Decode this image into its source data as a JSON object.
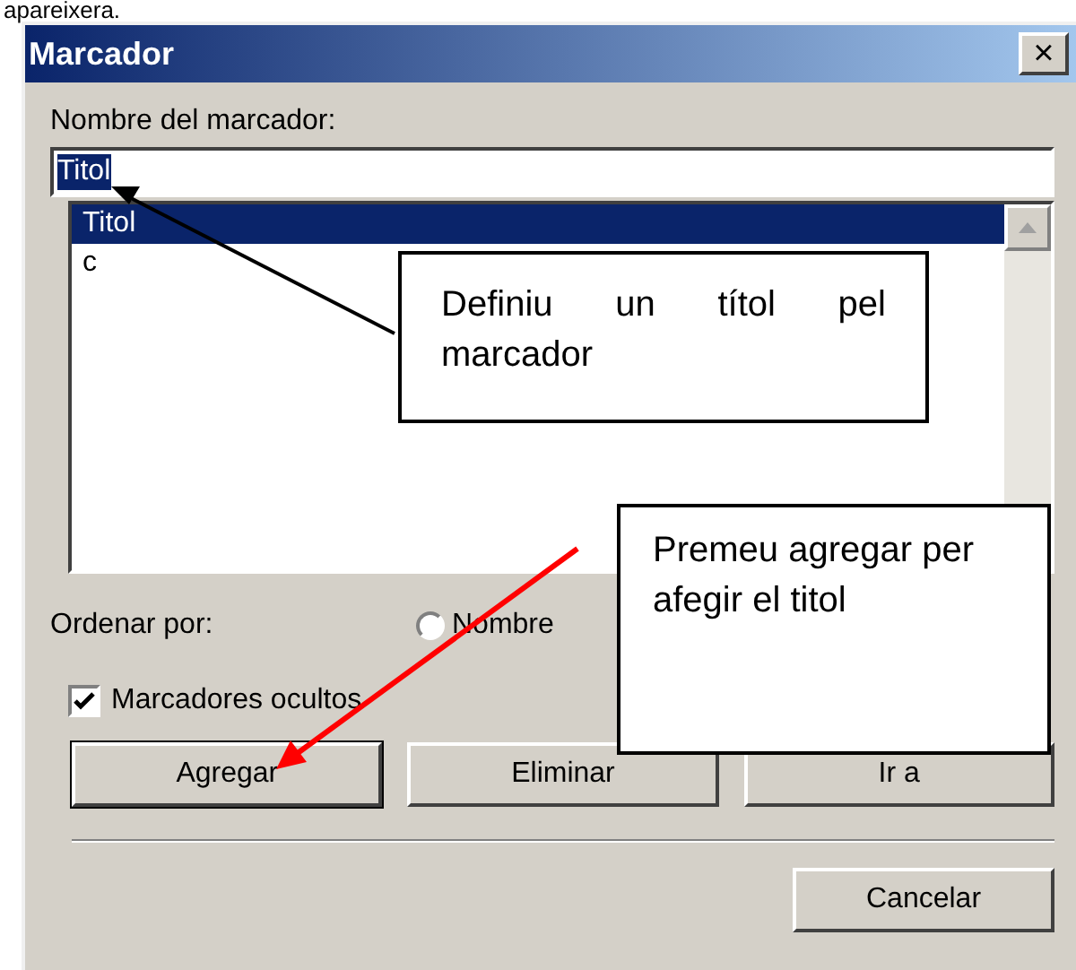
{
  "page_text": "apareixera.",
  "window": {
    "title": "Marcador",
    "close": "×"
  },
  "name_label": "Nombre del marcador:",
  "name_field": {
    "value": "Titol"
  },
  "list": [
    {
      "label": "Titol",
      "selected": true
    },
    {
      "label": "c",
      "selected": false
    }
  ],
  "sort_label": "Ordenar por:",
  "sort_options": [
    {
      "label": "Nombre",
      "selected": false
    }
  ],
  "hidden_checkbox": {
    "label": "Marcadores ocultos",
    "checked": true
  },
  "buttons": [
    "Agregar",
    "Eliminar",
    "Ir a"
  ],
  "cancel": "Cancelar",
  "callouts": [
    {
      "text": "Definiu un títol pel marcador",
      "color": "#000000"
    },
    {
      "text": "Premeu agregar per afegir el titol",
      "color": "#ff0000"
    }
  ]
}
